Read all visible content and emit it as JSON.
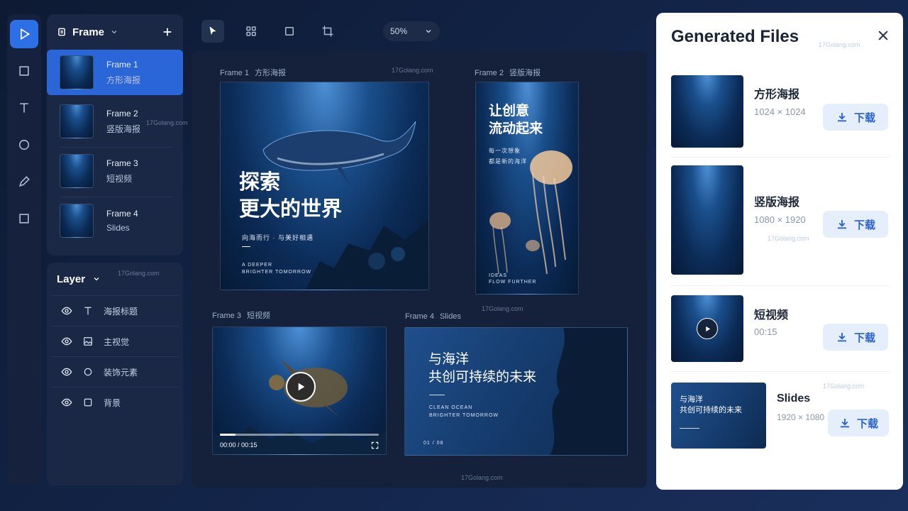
{
  "frame_panel": {
    "title": "Frame",
    "items": [
      {
        "name": "Frame 1",
        "sub": "方形海报"
      },
      {
        "name": "Frame 2",
        "sub": "竖版海报"
      },
      {
        "name": "Frame 3",
        "sub": "短视频"
      },
      {
        "name": "Frame 4",
        "sub": "Slides"
      }
    ]
  },
  "layer_panel": {
    "title": "Layer",
    "items": [
      "海报标题",
      "主视觉",
      "装饰元素",
      "背景"
    ]
  },
  "toolbar": {
    "zoom": "50%"
  },
  "canvas": {
    "frame1": {
      "label": "Frame 1",
      "label_sub": "方形海报",
      "title_line1": "探索",
      "title_line2": "更大的世界",
      "subtitle": "向海而行 · 与美好相遇",
      "tag_line1": "A DEEPER",
      "tag_line2": "BRIGHTER TOMORROW"
    },
    "frame2": {
      "label": "Frame 2",
      "label_sub": "竖版海报",
      "title_line1": "让创意",
      "title_line2": "流动起来",
      "subtitle_line1": "每一次想象",
      "subtitle_line2": "都是新的海洋",
      "tag_line1": "IDEAS",
      "tag_line2": "FLOW FURTHER"
    },
    "frame3": {
      "label": "Frame 3",
      "label_sub": "短视频",
      "time": "00:00 / 00:15",
      "progress": 0.1
    },
    "frame4": {
      "label": "Frame 4",
      "label_sub": "Slides",
      "title_line1": "与海洋",
      "title_line2": "共创可持续的未来",
      "tag_line1": "CLEAN OCEAN",
      "tag_line2": "BRIGHTER TOMORROW",
      "page": "01 / 08"
    }
  },
  "files_panel": {
    "title": "Generated Files",
    "files": [
      {
        "name": "方形海报",
        "size": "1024 × 1024",
        "button": "下载"
      },
      {
        "name": "竖版海报",
        "size": "1080 × 1920",
        "button": "下载"
      },
      {
        "name": "短视频",
        "size": "00:15",
        "button": "下载"
      },
      {
        "name": "Slides",
        "size": "1920 × 1080",
        "button": "下载",
        "thumb_line1": "与海洋",
        "thumb_line2": "共创可持续的未来"
      }
    ]
  },
  "watermark": "17Golang.com",
  "colors": {
    "accent": "#2d6fe6",
    "panel": "#1a2745",
    "background": "#0e1a33"
  }
}
